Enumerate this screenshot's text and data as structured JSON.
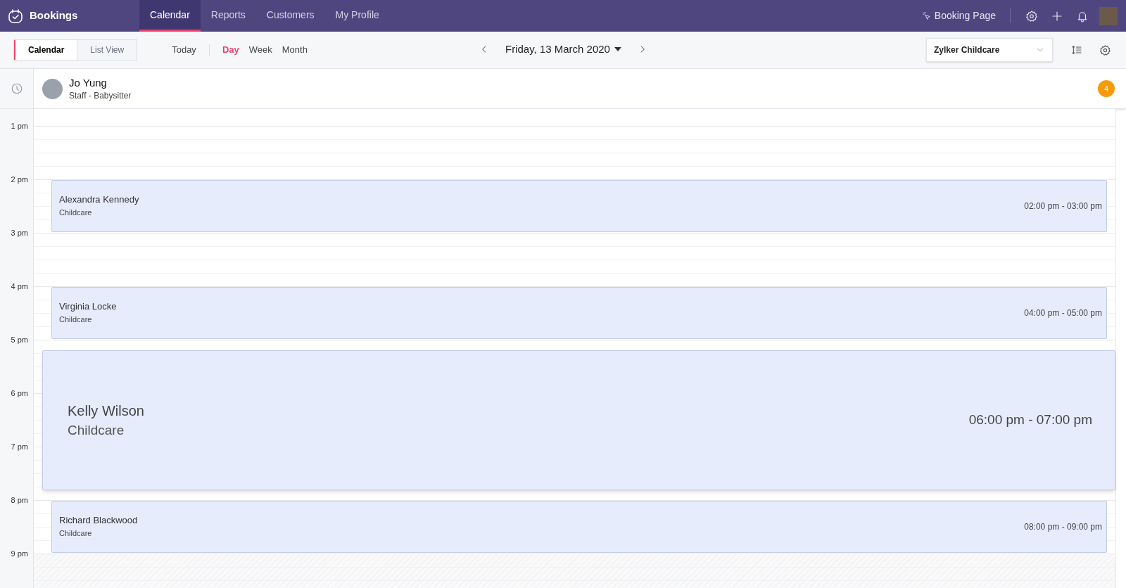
{
  "app": {
    "name": "Bookings"
  },
  "nav_tabs": [
    {
      "label": "Calendar",
      "selected": true
    },
    {
      "label": "Reports",
      "selected": false
    },
    {
      "label": "Customers",
      "selected": false
    },
    {
      "label": "My Profile",
      "selected": false
    }
  ],
  "booking_page_link": "Booking Page",
  "view_toggle": [
    {
      "label": "Calendar",
      "selected": true
    },
    {
      "label": "List View",
      "selected": false
    }
  ],
  "today_button": "Today",
  "range_tabs": [
    {
      "label": "Day",
      "selected": true
    },
    {
      "label": "Week",
      "selected": false
    },
    {
      "label": "Month",
      "selected": false
    }
  ],
  "date": "Friday, 13 March 2020",
  "workspace_select": "Zylker Childcare",
  "staff": {
    "name": "Jo Yung",
    "role": "Staff - Babysitter",
    "count": "4"
  },
  "hours": [
    "1 pm",
    "2 pm",
    "3 pm",
    "4 pm",
    "5 pm",
    "6 pm",
    "7 pm",
    "8 pm",
    "9 pm"
  ],
  "appointments": [
    {
      "customer": "Alexandra Kennedy",
      "service": "Childcare",
      "time": "02:00 pm - 03:00 pm",
      "kind": "compact"
    },
    {
      "customer": "Virginia Locke",
      "service": "Childcare",
      "time": "04:00 pm - 05:00 pm",
      "kind": "compact"
    },
    {
      "customer": "Kelly Wilson",
      "service": "Childcare",
      "time": "06:00 pm - 07:00 pm",
      "kind": "expanded"
    },
    {
      "customer": "Richard Blackwood",
      "service": "Childcare",
      "time": "08:00 pm - 09:00 pm",
      "kind": "compact"
    }
  ]
}
